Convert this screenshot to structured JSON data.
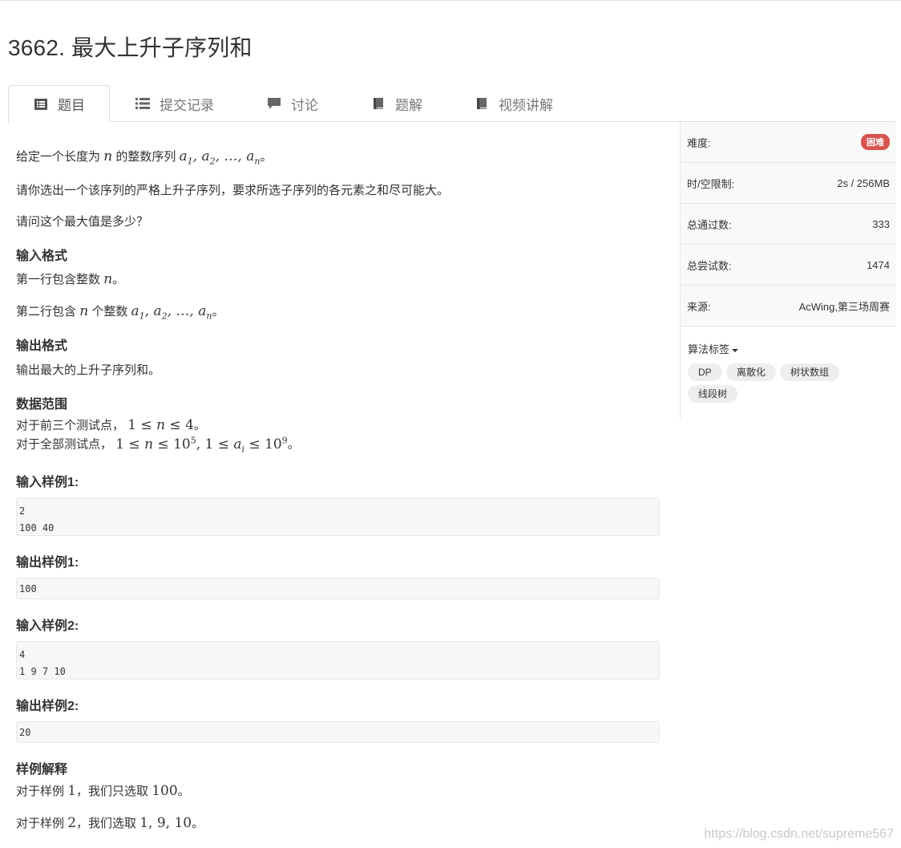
{
  "title": "3662. 最大上升子序列和",
  "tabs": [
    {
      "label": "题目",
      "icon": "list-alt-icon"
    },
    {
      "label": "提交记录",
      "icon": "list-icon"
    },
    {
      "label": "讨论",
      "icon": "comment-icon"
    },
    {
      "label": "题解",
      "icon": "book-icon"
    },
    {
      "label": "视频讲解",
      "icon": "book-icon"
    }
  ],
  "problem": {
    "p1_a": "给定一个长度为",
    "p1_b": "的整数序列",
    "p2": "请你选出一个该序列的严格上升子序列，要求所选子序列的各元素之和尽可能大。",
    "p3": "请问这个最大值是多少？",
    "input_format_title": "输入格式",
    "input_line1_a": "第一行包含整数",
    "input_line2_a": "第二行包含",
    "input_line2_b": "个整数",
    "output_format_title": "输出格式",
    "output_line": "输出最大的上升子序列和。",
    "range_title": "数据范围",
    "range_line1": "对于前三个测试点，",
    "range_line2": "对于全部测试点，",
    "sample_in1_title": "输入样例1:",
    "sample_in1": "2\n100 40",
    "sample_out1_title": "输出样例1:",
    "sample_out1": "100",
    "sample_in2_title": "输入样例2:",
    "sample_in2": "4\n1 9 7 10",
    "sample_out2_title": "输出样例2:",
    "sample_out2": "20",
    "explain_title": "样例解释",
    "explain1_a": "对于样例",
    "explain1_num": "1",
    "explain1_b": "，我们只选取",
    "explain1_val": "100",
    "explain2_a": "对于样例",
    "explain2_num": "2",
    "explain2_b": "，我们选取",
    "explain2_val": "1, 9, 10",
    "period": "。"
  },
  "side": {
    "difficulty_label": "难度:",
    "difficulty_value": "困难",
    "limit_label": "时/空限制:",
    "limit_value": "2s / 256MB",
    "passed_label": "总通过数:",
    "passed_value": "333",
    "tried_label": "总尝试数:",
    "tried_value": "1474",
    "source_label": "来源:",
    "source_value": "AcWing,第三场周赛",
    "tags_label": "算法标签",
    "tags": [
      "DP",
      "离散化",
      "树状数组",
      "线段树"
    ]
  },
  "watermark": "https://blog.csdn.net/supreme567",
  "colors": {
    "badge": "#d9534f",
    "tag_bg": "#eeeeee",
    "code_bg": "#f7f7f9"
  }
}
